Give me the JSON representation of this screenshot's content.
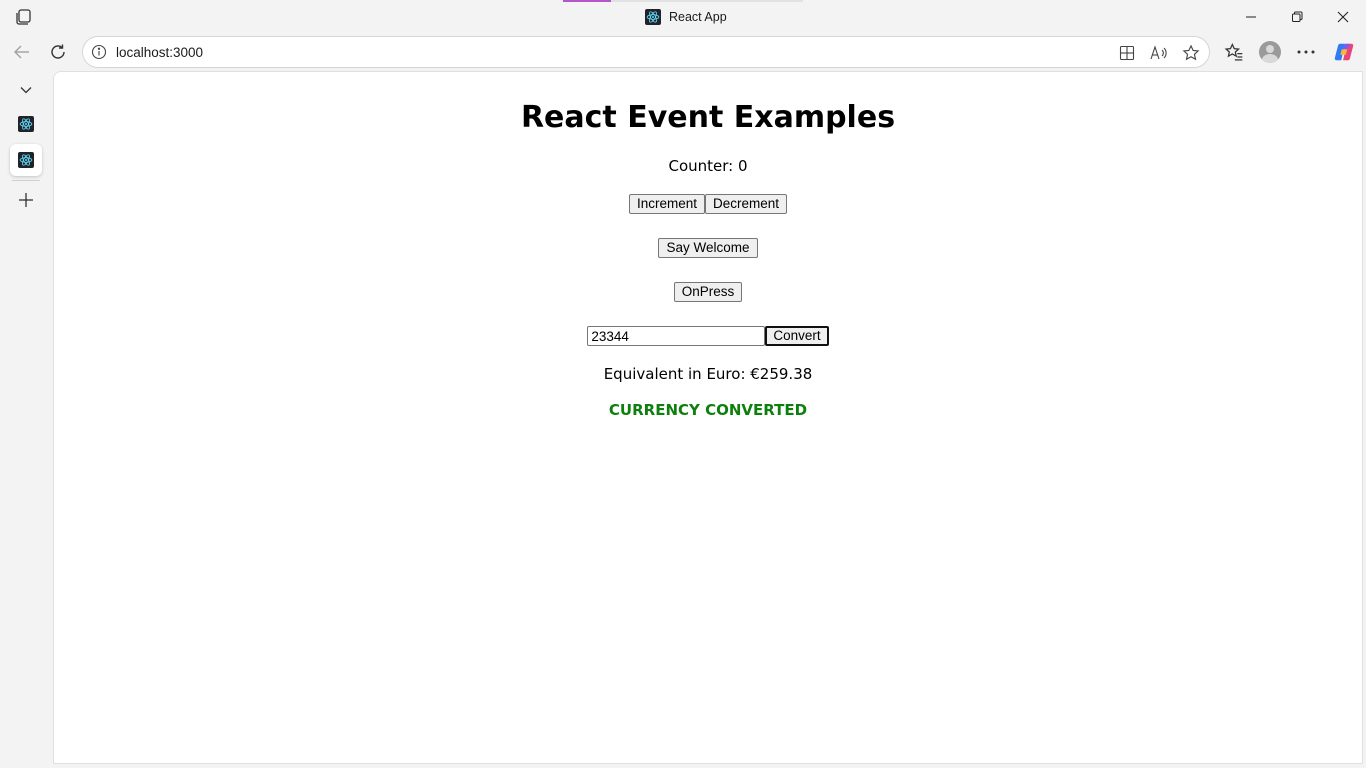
{
  "browser": {
    "window_title": "React App",
    "url": "localhost:3000"
  },
  "page": {
    "heading": "React Event Examples",
    "counter_text": "Counter: 0",
    "increment_label": "Increment",
    "decrement_label": "Decrement",
    "welcome_label": "Say Welcome",
    "onpress_label": "OnPress",
    "amount_value": "23344",
    "convert_label": "Convert",
    "euro_text": "Equivalent in Euro: €259.38",
    "status_text": "CURRENCY CONVERTED"
  },
  "colors": {
    "status_green": "#0d7f0d",
    "tab_accent": "#b455c8",
    "react_logo": "#61dafb"
  }
}
